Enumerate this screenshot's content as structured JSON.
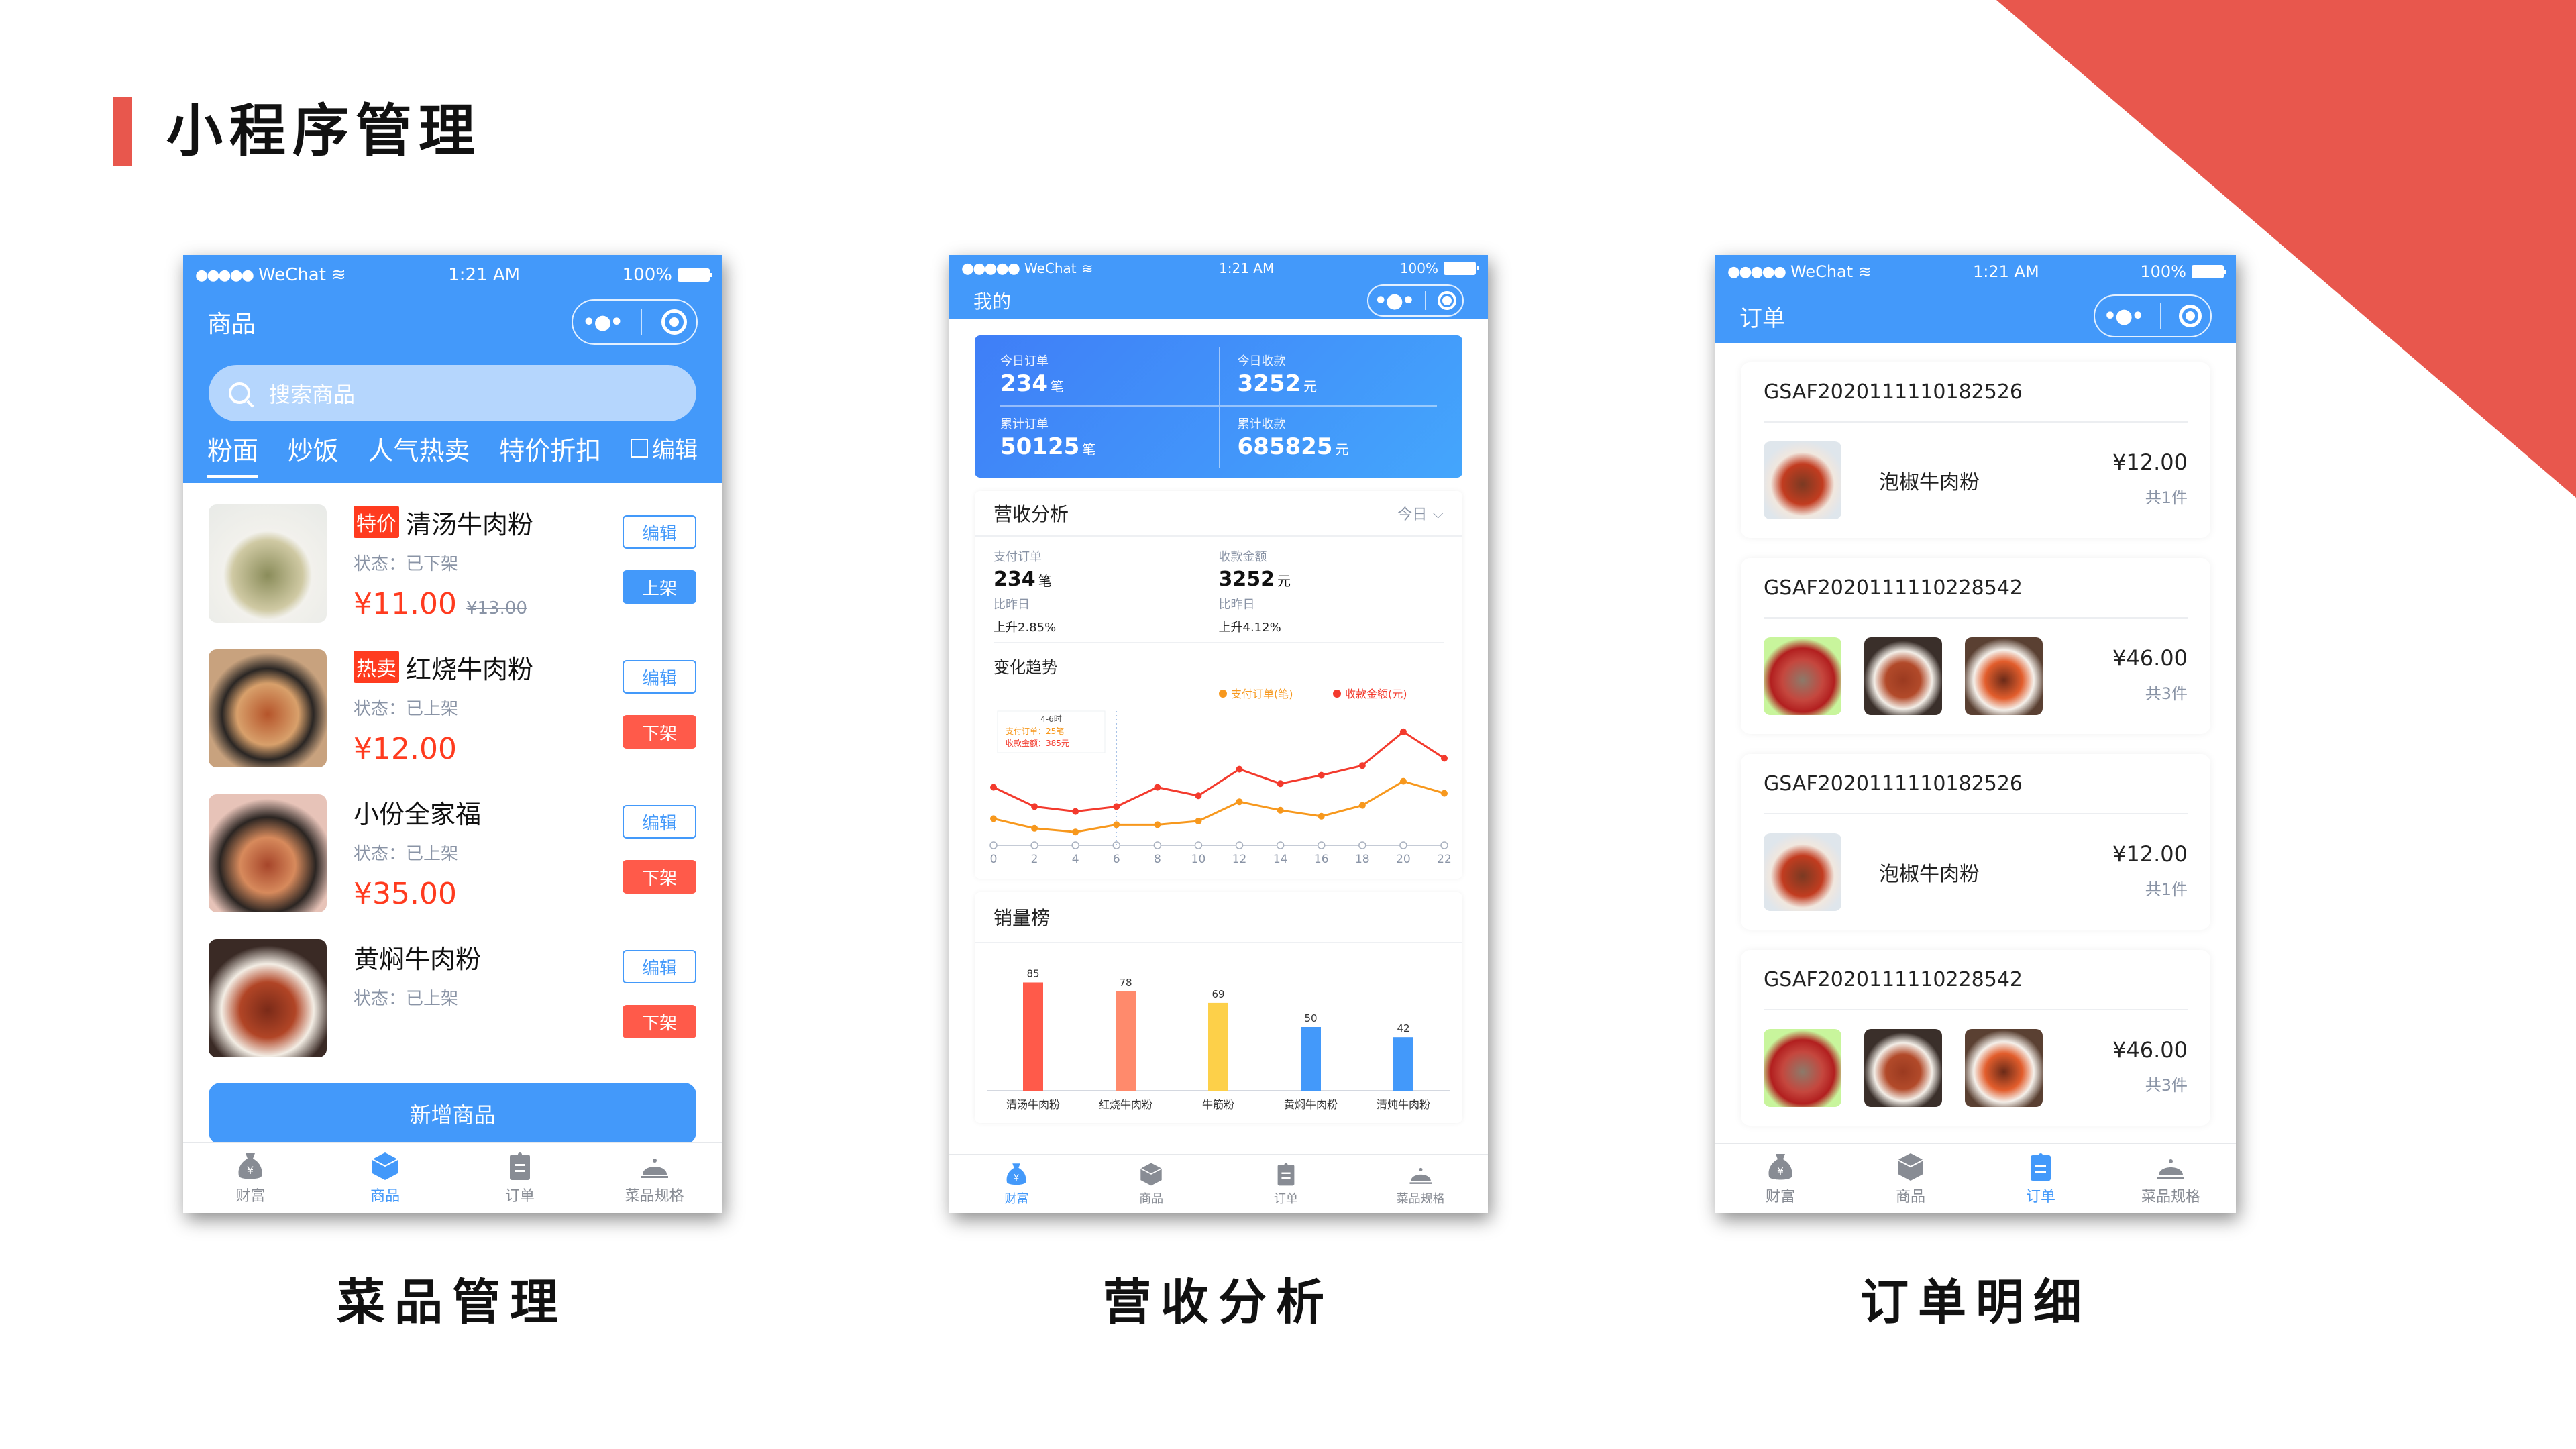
{
  "slide": {
    "title": "小程序管理",
    "accent_color": "#e8574d",
    "captions": [
      "菜品管理",
      "营收分析",
      "订单明细"
    ]
  },
  "status_bar": {
    "carrier": "WeChat",
    "time": "1:21 AM",
    "battery": "100%"
  },
  "tabbar": {
    "items": [
      {
        "label": "财富",
        "icon": "money-bag-icon"
      },
      {
        "label": "商品",
        "icon": "cube-icon"
      },
      {
        "label": "订单",
        "icon": "clipboard-icon"
      },
      {
        "label": "菜品规格",
        "icon": "cloche-icon"
      }
    ],
    "active_color": "#4399fa",
    "inactive_color": "#888c94"
  },
  "goods_screen": {
    "nav_title": "商品",
    "search_placeholder": "搜索商品",
    "categories": [
      "粉面",
      "炒饭",
      "人气热卖",
      "特价折扣"
    ],
    "active_category": "粉面",
    "edit_label": "编辑",
    "products": [
      {
        "tag": "特价",
        "name": "清汤牛肉粉",
        "status": "状态：已下架",
        "price": "¥11.00",
        "old_price": "¥13.00",
        "edit": "编辑",
        "action": "上架",
        "action_type": "blue"
      },
      {
        "tag": "热卖",
        "name": "红烧牛肉粉",
        "status": "状态：已上架",
        "price": "¥12.00",
        "old_price": "",
        "edit": "编辑",
        "action": "下架",
        "action_type": "red"
      },
      {
        "tag": "",
        "name": "小份全家福",
        "status": "状态：已上架",
        "price": "¥35.00",
        "old_price": "",
        "edit": "编辑",
        "action": "下架",
        "action_type": "red"
      },
      {
        "tag": "",
        "name": "黄焖牛肉粉",
        "status": "状态：已上架",
        "price": "",
        "old_price": "",
        "edit": "编辑",
        "action": "下架",
        "action_type": "red"
      }
    ],
    "add_button": "新增商品",
    "active_tab": 1
  },
  "revenue_screen": {
    "nav_title": "我的",
    "summary": [
      {
        "label": "今日订单",
        "value": "234",
        "unit": "笔"
      },
      {
        "label": "今日收款",
        "value": "3252",
        "unit": "元"
      },
      {
        "label": "累计订单",
        "value": "50125",
        "unit": "笔"
      },
      {
        "label": "累计收款",
        "value": "685825",
        "unit": "元"
      }
    ],
    "analysis": {
      "title": "营收分析",
      "period": "今日",
      "metrics": [
        {
          "label": "支付订单",
          "value": "234",
          "unit": "笔",
          "compare_label": "比昨日",
          "change": "上升2.85%"
        },
        {
          "label": "收款金额",
          "value": "3252",
          "unit": "元",
          "compare_label": "比昨日",
          "change": "上升4.12%"
        }
      ],
      "trend_title": "变化趋势",
      "tooltip": {
        "title": "4-6时",
        "orders": "支付订单：25笔",
        "amount": "收款金额：385元"
      }
    },
    "ranking_title": "销量榜",
    "active_tab": 0
  },
  "orders_screen": {
    "nav_title": "订单",
    "orders": [
      {
        "order_no": "GSAF2020111110182526",
        "item_name": "泡椒牛肉粉",
        "thumbs": [
          "food-5"
        ],
        "price": "¥12.00",
        "count": "共1件"
      },
      {
        "order_no": "GSAF2020111110228542",
        "item_name": "",
        "thumbs": [
          "food-6",
          "food-7",
          "food-8"
        ],
        "price": "¥46.00",
        "count": "共3件"
      },
      {
        "order_no": "GSAF2020111110182526",
        "item_name": "泡椒牛肉粉",
        "thumbs": [
          "food-5"
        ],
        "price": "¥12.00",
        "count": "共1件"
      },
      {
        "order_no": "GSAF2020111110228542",
        "item_name": "",
        "thumbs": [
          "food-6",
          "food-7",
          "food-8"
        ],
        "price": "¥46.00",
        "count": "共3件"
      }
    ],
    "active_tab": 2
  },
  "chart_data": [
    {
      "type": "line",
      "title": "变化趋势",
      "x": [
        0,
        2,
        4,
        6,
        8,
        10,
        12,
        14,
        16,
        18,
        20,
        22
      ],
      "xlabel": "",
      "ylabel": "",
      "ylim": [
        0,
        100
      ],
      "grid": false,
      "legend": "top-right",
      "series": [
        {
          "name": "支付订单(笔)",
          "color": "#f7981d",
          "values": [
            22,
            14,
            11,
            17,
            17,
            20,
            36,
            29,
            24,
            33,
            53,
            43
          ]
        },
        {
          "name": "收款金额(元)",
          "color": "#f33a2d",
          "values": [
            48,
            32,
            28,
            32,
            48,
            41,
            63,
            51,
            58,
            66,
            94,
            72
          ]
        }
      ],
      "tooltip": {
        "x_range": "4-6时",
        "orders": 25,
        "amount": 385
      }
    },
    {
      "type": "bar",
      "title": "销量榜",
      "categories": [
        "清汤牛肉粉",
        "红烧牛肉粉",
        "牛筋粉",
        "黄焖牛肉粉",
        "清炖牛肉粉"
      ],
      "values": [
        85,
        78,
        69,
        50,
        42
      ],
      "colors": [
        "#ff5a4a",
        "#ff8a6c",
        "#fdd049",
        "#4399fa",
        "#4399fa"
      ],
      "ylim": [
        0,
        100
      ],
      "show_data_labels": true
    }
  ]
}
